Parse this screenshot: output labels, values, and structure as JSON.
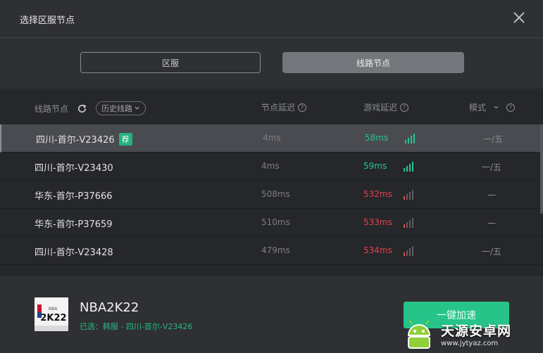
{
  "header": {
    "title": "选择区服节点"
  },
  "tabs": [
    {
      "label": "区服",
      "active": false
    },
    {
      "label": "线路节点",
      "active": true
    }
  ],
  "table": {
    "columns": {
      "node": "线路节点",
      "history": "历史线路",
      "node_latency": "节点延迟",
      "game_latency": "游戏延迟",
      "mode": "模式"
    },
    "rows": [
      {
        "name": "四川-首尔-V23426",
        "badge": "荐",
        "node_latency": "4ms",
        "game_latency": "58ms",
        "status": "good",
        "mode": "一/五"
      },
      {
        "name": "四川-首尔-V23430",
        "badge": "",
        "node_latency": "4ms",
        "game_latency": "59ms",
        "status": "good",
        "mode": "一/五"
      },
      {
        "name": "华东-首尔-P37666",
        "badge": "",
        "node_latency": "508ms",
        "game_latency": "532ms",
        "status": "bad",
        "mode": "一"
      },
      {
        "name": "华东-首尔-P37659",
        "badge": "",
        "node_latency": "510ms",
        "game_latency": "533ms",
        "status": "bad",
        "mode": "一"
      },
      {
        "name": "四川-首尔-V23428",
        "badge": "",
        "node_latency": "479ms",
        "game_latency": "534ms",
        "status": "bad",
        "mode": "一/五"
      }
    ]
  },
  "footer": {
    "game_title": "NBA2K22",
    "cover_text": "2K22",
    "cover_brand": "NBA",
    "selected": "已选：韩服 - 四川-首尔-V23426",
    "accelerate_label": "一键加速"
  },
  "watermark": {
    "name": "天源安卓网",
    "url": "www.jytyaz.com"
  },
  "colors": {
    "good": "#27c48a",
    "bad": "#e0454a",
    "accent": "#22b27b"
  }
}
